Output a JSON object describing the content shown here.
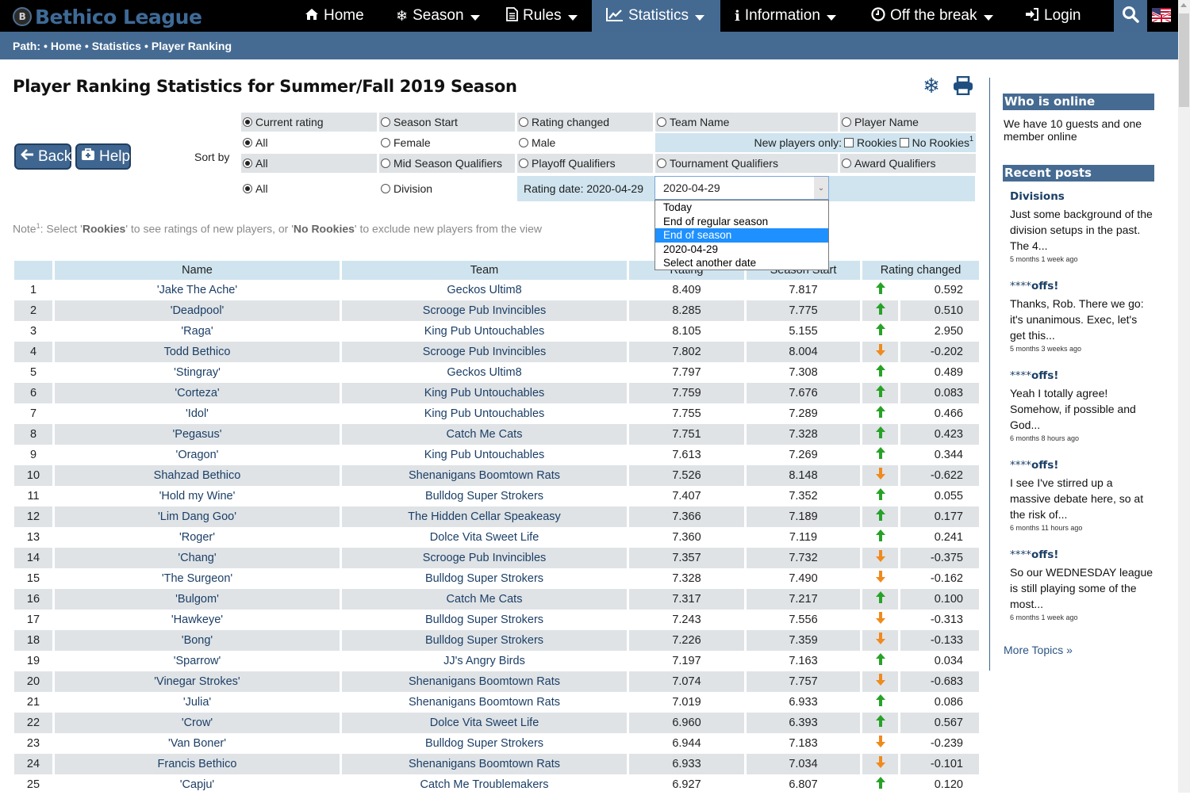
{
  "nav": {
    "logo_text": "Bethico League",
    "logo_ball_glyph": "B",
    "items": [
      {
        "label": "Home",
        "icon": "home-icon",
        "dropdown": false,
        "active": false
      },
      {
        "label": "Season",
        "icon": "snowflake-icon",
        "dropdown": true,
        "active": false
      },
      {
        "label": "Rules",
        "icon": "document-icon",
        "dropdown": true,
        "active": false
      },
      {
        "label": "Statistics",
        "icon": "line-chart-icon",
        "dropdown": true,
        "active": true
      },
      {
        "label": "Information",
        "icon": "info-icon",
        "dropdown": true,
        "active": false
      },
      {
        "label": "Off the break",
        "icon": "clock-icon",
        "dropdown": true,
        "active": false
      },
      {
        "label": "Login",
        "icon": "sign-in-icon",
        "dropdown": false,
        "active": false
      }
    ],
    "search_icon": "search-icon",
    "flag_icon": "us-uk-flag-icon"
  },
  "breadcrumb": {
    "prefix": "Path:",
    "separator": "•",
    "items": [
      "Home",
      "Statistics",
      "Player Ranking"
    ]
  },
  "page": {
    "title": "Player Ranking Statistics for Summer/Fall 2019 Season",
    "title_icons": [
      "snowflake-icon",
      "print-icon"
    ],
    "back_label": "Back",
    "help_label": "Help",
    "sort_by_label": "Sort by"
  },
  "filters": {
    "sort_options": [
      {
        "label": "Current rating",
        "checked": true
      },
      {
        "label": "Season Start",
        "checked": false
      },
      {
        "label": "Rating changed",
        "checked": false
      },
      {
        "label": "Team Name",
        "checked": false
      },
      {
        "label": "Player Name",
        "checked": false
      }
    ],
    "gender_options": [
      {
        "label": "All",
        "checked": true
      },
      {
        "label": "Female",
        "checked": false
      },
      {
        "label": "Male",
        "checked": false
      }
    ],
    "new_players_label": "New players only:",
    "rookies_label": "Rookies",
    "rookies_checked": false,
    "no_rookies_label": "No Rookies",
    "no_rookies_checked": false,
    "no_rookies_sup": "1",
    "qualifier_options": [
      {
        "label": "All",
        "checked": true
      },
      {
        "label": "Mid Season Qualifiers",
        "checked": false
      },
      {
        "label": "Playoff Qualifiers",
        "checked": false
      },
      {
        "label": "Tournament Qualifiers",
        "checked": false
      },
      {
        "label": "Award Qualifiers",
        "checked": false
      }
    ],
    "division_options": [
      {
        "label": "All",
        "checked": true
      },
      {
        "label": "Division",
        "checked": false
      }
    ],
    "rating_date_label": "Rating date: 2020-04-29",
    "rating_date_select": {
      "value": "2020-04-29",
      "options": [
        "Today",
        "End of regular season",
        "End of season",
        "2020-04-29",
        "Select another date"
      ],
      "highlighted": "End of season"
    }
  },
  "note": {
    "prefix": "Note",
    "sup": "1",
    "text_1": ": Select '",
    "bold_1": "Rookies",
    "text_2": "' to see ratings of new players, or '",
    "bold_2": "No Rookies",
    "text_3": "' to exclude new players from the view"
  },
  "table": {
    "columns": [
      "",
      "Name",
      "Team",
      "Rating",
      "Season Start",
      "Rating changed"
    ],
    "rows": [
      {
        "rank": "1",
        "name": "'Jake The Ache'",
        "team": "Geckos Ultim8",
        "rating": "8.409",
        "season_start": "7.817",
        "direction": "up",
        "change": "0.592"
      },
      {
        "rank": "2",
        "name": "'Deadpool'",
        "team": "Scrooge Pub Invincibles",
        "rating": "8.285",
        "season_start": "7.775",
        "direction": "up",
        "change": "0.510"
      },
      {
        "rank": "3",
        "name": "'Raga'",
        "team": "King Pub Untouchables",
        "rating": "8.105",
        "season_start": "5.155",
        "direction": "up",
        "change": "2.950"
      },
      {
        "rank": "4",
        "name": "Todd Bethico",
        "team": "Scrooge Pub Invincibles",
        "rating": "7.802",
        "season_start": "8.004",
        "direction": "down",
        "change": "-0.202"
      },
      {
        "rank": "5",
        "name": "'Stingray'",
        "team": "Geckos Ultim8",
        "rating": "7.797",
        "season_start": "7.308",
        "direction": "up",
        "change": "0.489"
      },
      {
        "rank": "6",
        "name": "'Corteza'",
        "team": "King Pub Untouchables",
        "rating": "7.759",
        "season_start": "7.676",
        "direction": "up",
        "change": "0.083"
      },
      {
        "rank": "7",
        "name": "'Idol'",
        "team": "King Pub Untouchables",
        "rating": "7.755",
        "season_start": "7.289",
        "direction": "up",
        "change": "0.466"
      },
      {
        "rank": "8",
        "name": "'Pegasus'",
        "team": "Catch Me Cats",
        "rating": "7.751",
        "season_start": "7.328",
        "direction": "up",
        "change": "0.423"
      },
      {
        "rank": "9",
        "name": "'Oragon'",
        "team": "King Pub Untouchables",
        "rating": "7.613",
        "season_start": "7.269",
        "direction": "up",
        "change": "0.344"
      },
      {
        "rank": "10",
        "name": "Shahzad Bethico",
        "team": "Shenanigans Boomtown Rats",
        "rating": "7.526",
        "season_start": "8.148",
        "direction": "down",
        "change": "-0.622"
      },
      {
        "rank": "11",
        "name": "'Hold my Wine'",
        "team": "Bulldog Super Strokers",
        "rating": "7.407",
        "season_start": "7.352",
        "direction": "up",
        "change": "0.055"
      },
      {
        "rank": "12",
        "name": "'Lim Dang Goo'",
        "team": "The Hidden Cellar Speakeasy",
        "rating": "7.366",
        "season_start": "7.189",
        "direction": "up",
        "change": "0.177"
      },
      {
        "rank": "13",
        "name": "'Roger'",
        "team": "Dolce Vita Sweet Life",
        "rating": "7.360",
        "season_start": "7.119",
        "direction": "up",
        "change": "0.241"
      },
      {
        "rank": "14",
        "name": "'Chang'",
        "team": "Scrooge Pub Invincibles",
        "rating": "7.357",
        "season_start": "7.732",
        "direction": "down",
        "change": "-0.375"
      },
      {
        "rank": "15",
        "name": "'The Surgeon'",
        "team": "Bulldog Super Strokers",
        "rating": "7.328",
        "season_start": "7.490",
        "direction": "down",
        "change": "-0.162"
      },
      {
        "rank": "16",
        "name": "'Bulgom'",
        "team": "Catch Me Cats",
        "rating": "7.317",
        "season_start": "7.217",
        "direction": "up",
        "change": "0.100"
      },
      {
        "rank": "17",
        "name": "'Hawkeye'",
        "team": "Bulldog Super Strokers",
        "rating": "7.243",
        "season_start": "7.556",
        "direction": "down",
        "change": "-0.313"
      },
      {
        "rank": "18",
        "name": "'Bong'",
        "team": "Bulldog Super Strokers",
        "rating": "7.226",
        "season_start": "7.359",
        "direction": "down",
        "change": "-0.133"
      },
      {
        "rank": "19",
        "name": "'Sparrow'",
        "team": "JJ's Angry Birds",
        "rating": "7.197",
        "season_start": "7.163",
        "direction": "up",
        "change": "0.034"
      },
      {
        "rank": "20",
        "name": "'Vinegar Strokes'",
        "team": "Shenanigans Boomtown Rats",
        "rating": "7.074",
        "season_start": "7.757",
        "direction": "down",
        "change": "-0.683"
      },
      {
        "rank": "21",
        "name": "'Julia'",
        "team": "Shenanigans Boomtown Rats",
        "rating": "7.019",
        "season_start": "6.933",
        "direction": "up",
        "change": "0.086"
      },
      {
        "rank": "22",
        "name": "'Crow'",
        "team": "Dolce Vita Sweet Life",
        "rating": "6.960",
        "season_start": "6.393",
        "direction": "up",
        "change": "0.567"
      },
      {
        "rank": "23",
        "name": "'Van Boner'",
        "team": "Bulldog Super Strokers",
        "rating": "6.944",
        "season_start": "7.183",
        "direction": "down",
        "change": "-0.239"
      },
      {
        "rank": "24",
        "name": "Francis Bethico",
        "team": "Shenanigans Boomtown Rats",
        "rating": "6.933",
        "season_start": "7.034",
        "direction": "down",
        "change": "-0.101"
      },
      {
        "rank": "25",
        "name": "'Capju'",
        "team": "Catch Me Troublemakers",
        "rating": "6.927",
        "season_start": "6.807",
        "direction": "up",
        "change": "0.120"
      }
    ]
  },
  "sidebar": {
    "who_online_title": "Who is online",
    "who_online_text": "We have 10 guests and one member online",
    "recent_posts_title": "Recent posts",
    "posts": [
      {
        "stars": "",
        "title": "Divisions",
        "body": "Just some background of the division setups in the past. The 4...",
        "time": "5 months 1 week ago"
      },
      {
        "stars": "****",
        "title": "offs!",
        "body": "Thanks, Rob. There we go: it's unanimous. Exec, let's get this...",
        "time": "5 months 3 weeks ago"
      },
      {
        "stars": "****",
        "title": "offs!",
        "body": "Yeah I totally agree! Somehow, if possible and God...",
        "time": "6 months 8 hours ago"
      },
      {
        "stars": "****",
        "title": "offs!",
        "body": "I see I've stirred up a massive debate here, so at the risk of...",
        "time": "6 months 11 hours ago"
      },
      {
        "stars": "****",
        "title": "offs!",
        "body": "So our WEDNESDAY league is still playing some of the most...",
        "time": "6 months 1 week ago"
      }
    ],
    "more_topics": "More Topics »"
  },
  "colors": {
    "nav_bg": "#000000",
    "accent_blue": "#466b92",
    "header_cell": "#cfe4ef",
    "alt_row": "#dfe3e6",
    "up_arrow": "#27a227",
    "down_arrow": "#f08a1c",
    "dropdown_highlight": "#1e90ff"
  }
}
